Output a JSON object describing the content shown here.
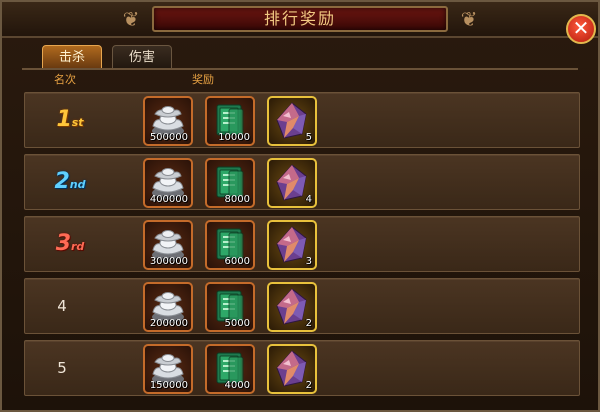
{
  "window": {
    "title": "排行奖励",
    "close_label": "✕"
  },
  "tabs": [
    {
      "label": "击杀",
      "active": true
    },
    {
      "label": "伤害",
      "active": false
    }
  ],
  "columns": {
    "rank": "名次",
    "reward": "奖励"
  },
  "rows": [
    {
      "rank": "1",
      "suffix": "st",
      "silver": "500000",
      "book": "10000",
      "gem": "5"
    },
    {
      "rank": "2",
      "suffix": "nd",
      "silver": "400000",
      "book": "8000",
      "gem": "4"
    },
    {
      "rank": "3",
      "suffix": "rd",
      "silver": "300000",
      "book": "6000",
      "gem": "3"
    },
    {
      "rank": "4",
      "suffix": "",
      "silver": "200000",
      "book": "5000",
      "gem": "2"
    },
    {
      "rank": "5",
      "suffix": "",
      "silver": "150000",
      "book": "4000",
      "gem": "2"
    }
  ],
  "icons": {
    "silver": "silver-ingot-icon",
    "book": "jade-book-icon",
    "gem": "crystal-gem-icon"
  },
  "colors": {
    "accent": "#e8a243",
    "close_button": "#d9321a",
    "gold_border": "#e8c13c"
  }
}
